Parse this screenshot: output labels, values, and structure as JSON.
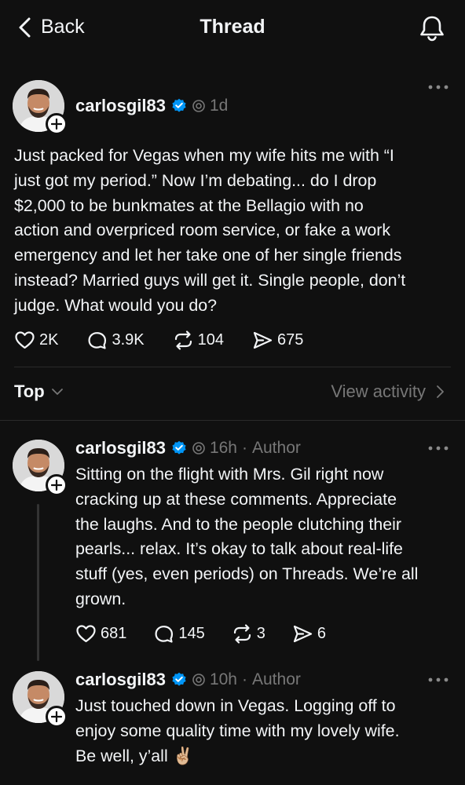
{
  "header": {
    "back_label": "Back",
    "title": "Thread"
  },
  "main_post": {
    "username": "carlosgil83",
    "time": "1d",
    "text": "Just packed for Vegas when my wife hits me with “I\njust got my period.” Now I’m debating... do I drop\n$2,000 to be bunkmates at the Bellagio with no\naction and overpriced room service, or fake a work\nemergency and let her take one of her single friends\ninstead? Married guys will get it. Single people, don’t\njudge. What would you do?",
    "likes": "2K",
    "replies": "3.9K",
    "reposts": "104",
    "shares": "675"
  },
  "sort_bar": {
    "sort_label": "Top",
    "view_activity": "View activity"
  },
  "replies": [
    {
      "username": "carlosgil83",
      "time": "16h",
      "author_tag": "Author",
      "text": "Sitting on the flight with Mrs. Gil right now\ncracking up at these comments. Appreciate\nthe laughs. And to the people clutching their\npearls... relax. It’s okay to talk about real-life\nstuff (yes, even periods) on Threads. We’re all\ngrown.",
      "likes": "681",
      "replies": "145",
      "reposts": "3",
      "shares": "6"
    },
    {
      "username": "carlosgil83",
      "time": "10h",
      "author_tag": "Author",
      "text": "Just touched down in Vegas. Logging off to\nenjoy some quality time with my lovely wife.\nBe well, y’all ✌🏼"
    }
  ],
  "colors": {
    "background": "#101010",
    "text": "#f3f5f7",
    "muted": "#777777",
    "verified": "#0095f6"
  },
  "icons": [
    "chevron-left-icon",
    "bell-icon",
    "verified-badge-icon",
    "threads-icon",
    "more-icon",
    "heart-icon",
    "comment-icon",
    "repost-icon",
    "share-icon",
    "chevron-down-icon",
    "chevron-right-icon",
    "plus-icon"
  ]
}
